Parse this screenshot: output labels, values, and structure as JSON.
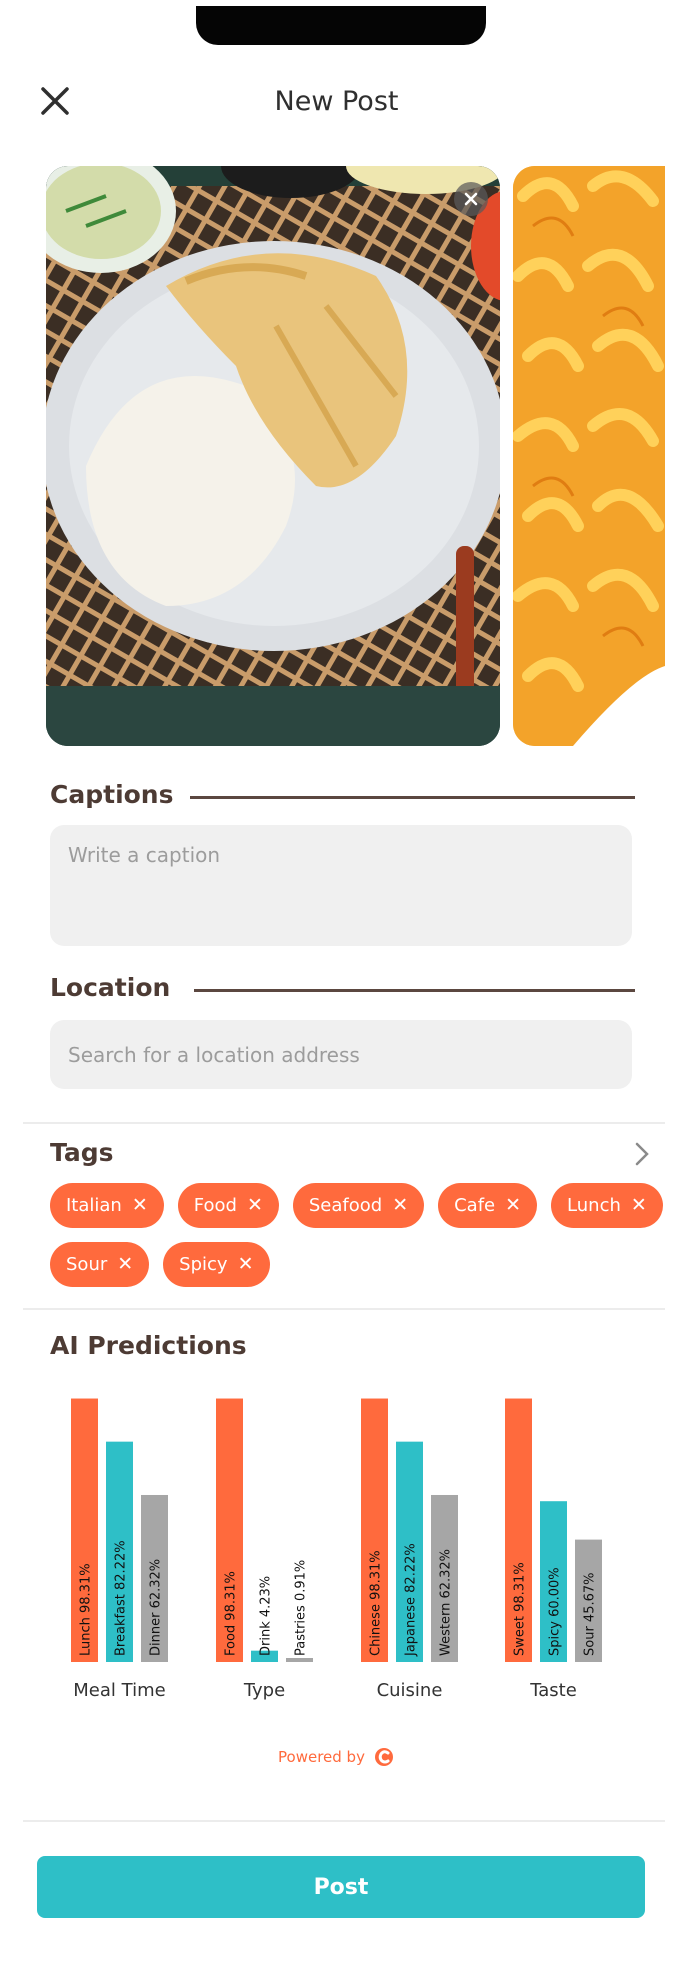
{
  "header": {
    "title": "New Post"
  },
  "captions": {
    "label": "Captions",
    "placeholder": "Write a caption",
    "value": ""
  },
  "location": {
    "label": "Location",
    "placeholder": "Search for a location address",
    "value": ""
  },
  "tags": {
    "label": "Tags",
    "items": [
      "Italian",
      "Food",
      "Seafood",
      "Cafe",
      "Lunch",
      "Sour",
      "Spicy"
    ]
  },
  "ai": {
    "label": "AI Predictions"
  },
  "chart_data": {
    "type": "bar",
    "categories": [
      "Meal Time",
      "Type",
      "Cuisine",
      "Taste"
    ],
    "ylim": [
      0,
      100
    ],
    "groups": [
      {
        "category": "Meal Time",
        "bars": [
          {
            "label": "Lunch 98.31%",
            "value": 98.31,
            "color": "#ff6a3d"
          },
          {
            "label": "Breakfast 82.22%",
            "value": 82.22,
            "color": "#2ebfc7"
          },
          {
            "label": "Dinner 62.32%",
            "value": 62.32,
            "color": "#a6a6a6"
          }
        ]
      },
      {
        "category": "Type",
        "bars": [
          {
            "label": "Food 98.31%",
            "value": 98.31,
            "color": "#ff6a3d"
          },
          {
            "label": "Drink 4.23%",
            "value": 4.23,
            "color": "#2ebfc7"
          },
          {
            "label": "Pastries 0.91%",
            "value": 0.91,
            "color": "#a6a6a6"
          }
        ]
      },
      {
        "category": "Cuisine",
        "bars": [
          {
            "label": "Chinese 98.31%",
            "value": 98.31,
            "color": "#ff6a3d"
          },
          {
            "label": "Japanese 82.22%",
            "value": 82.22,
            "color": "#2ebfc7"
          },
          {
            "label": "Western 62.32%",
            "value": 62.32,
            "color": "#a6a6a6"
          }
        ]
      },
      {
        "category": "Taste",
        "bars": [
          {
            "label": "Sweet 98.31%",
            "value": 98.31,
            "color": "#ff6a3d"
          },
          {
            "label": "Spicy 60.00%",
            "value": 60.0,
            "color": "#2ebfc7"
          },
          {
            "label": "Sour 45.67%",
            "value": 45.67,
            "color": "#a6a6a6"
          }
        ]
      }
    ]
  },
  "footer": {
    "powered_by": "Powered by",
    "post_label": "Post"
  },
  "colors": {
    "accent": "#ff6a3d",
    "teal": "#2ebfc7",
    "gray": "#a6a6a6",
    "brown": "#4d3b34"
  }
}
